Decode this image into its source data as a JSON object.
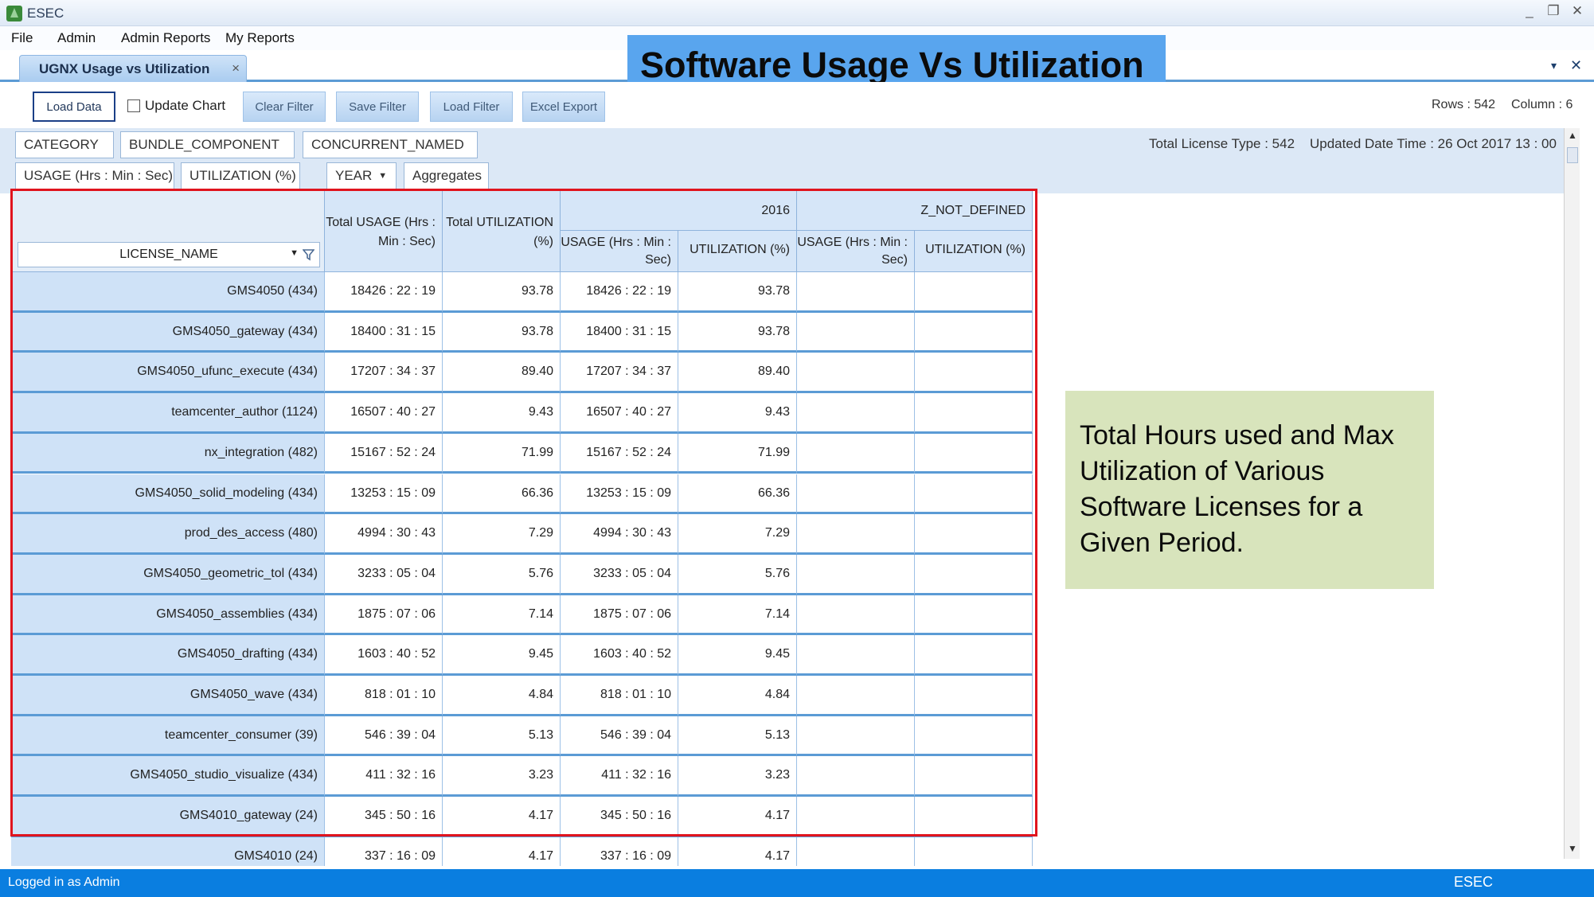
{
  "window": {
    "title": "ESEC",
    "minimize": "_",
    "restore": "❐",
    "close": "✕"
  },
  "menu": [
    "File",
    "Admin",
    "Admin Reports",
    "My Reports"
  ],
  "doc_tab": {
    "label": "UGNX Usage vs Utilization",
    "close": "×"
  },
  "strip_controls": {
    "dropdown": "▾",
    "close": "✕"
  },
  "banner": "Software  Usage Vs Utilization",
  "toolbar": {
    "load_data": "Load Data",
    "update_chart": "Update Chart",
    "clear_filter": "Clear Filter",
    "save_filter": "Save Filter",
    "load_filter": "Load Filter",
    "excel_export": "Excel Export",
    "rows": "Rows : 542",
    "columns": "Column : 6"
  },
  "filters": {
    "row1": [
      "CATEGORY",
      "BUNDLE_COMPONENT",
      "CONCURRENT_NAMED"
    ],
    "row2": [
      "USAGE (Hrs : Min : Sec)",
      "UTILIZATION (%)",
      "YEAR",
      "Aggregates"
    ],
    "total_license": "Total License Type : 542",
    "updated": "Updated Date Time : 26 Oct 2017   13 : 00"
  },
  "grid": {
    "row_header": "LICENSE_NAME",
    "total_usage_header": "Total USAGE (Hrs : Min : Sec)",
    "total_util_header": "Total UTILIZATION (%)",
    "group_2016": "2016",
    "group_undefined": "Z_NOT_DEFINED",
    "usage_sub": "USAGE (Hrs : Min : Sec)",
    "util_sub": "UTILIZATION (%)",
    "rows": [
      {
        "name": "GMS4050 (434)",
        "total_usage": "18426 : 22 : 19",
        "total_util": "93.78",
        "usage_2016": "18426 : 22 : 19",
        "util_2016": "93.78"
      },
      {
        "name": "GMS4050_gateway (434)",
        "total_usage": "18400 : 31 : 15",
        "total_util": "93.78",
        "usage_2016": "18400 : 31 : 15",
        "util_2016": "93.78"
      },
      {
        "name": "GMS4050_ufunc_execute (434)",
        "total_usage": "17207 : 34 : 37",
        "total_util": "89.40",
        "usage_2016": "17207 : 34 : 37",
        "util_2016": "89.40"
      },
      {
        "name": "teamcenter_author (1124)",
        "total_usage": "16507 : 40 : 27",
        "total_util": "9.43",
        "usage_2016": "16507 : 40 : 27",
        "util_2016": "9.43"
      },
      {
        "name": "nx_integration (482)",
        "total_usage": "15167 : 52 : 24",
        "total_util": "71.99",
        "usage_2016": "15167 : 52 : 24",
        "util_2016": "71.99"
      },
      {
        "name": "GMS4050_solid_modeling (434)",
        "total_usage": "13253 : 15 : 09",
        "total_util": "66.36",
        "usage_2016": "13253 : 15 : 09",
        "util_2016": "66.36"
      },
      {
        "name": "prod_des_access (480)",
        "total_usage": "4994 : 30 : 43",
        "total_util": "7.29",
        "usage_2016": "4994 : 30 : 43",
        "util_2016": "7.29"
      },
      {
        "name": "GMS4050_geometric_tol (434)",
        "total_usage": "3233 : 05 : 04",
        "total_util": "5.76",
        "usage_2016": "3233 : 05 : 04",
        "util_2016": "5.76"
      },
      {
        "name": "GMS4050_assemblies (434)",
        "total_usage": "1875 : 07 : 06",
        "total_util": "7.14",
        "usage_2016": "1875 : 07 : 06",
        "util_2016": "7.14"
      },
      {
        "name": "GMS4050_drafting (434)",
        "total_usage": "1603 : 40 : 52",
        "total_util": "9.45",
        "usage_2016": "1603 : 40 : 52",
        "util_2016": "9.45"
      },
      {
        "name": "GMS4050_wave (434)",
        "total_usage": "818 : 01 : 10",
        "total_util": "4.84",
        "usage_2016": "818 : 01 : 10",
        "util_2016": "4.84"
      },
      {
        "name": "teamcenter_consumer (39)",
        "total_usage": "546 : 39 : 04",
        "total_util": "5.13",
        "usage_2016": "546 : 39 : 04",
        "util_2016": "5.13"
      },
      {
        "name": "GMS4050_studio_visualize (434)",
        "total_usage": "411 : 32 : 16",
        "total_util": "3.23",
        "usage_2016": "411 : 32 : 16",
        "util_2016": "3.23"
      },
      {
        "name": "GMS4010_gateway (24)",
        "total_usage": "345 : 50 : 16",
        "total_util": "4.17",
        "usage_2016": "345 : 50 : 16",
        "util_2016": "4.17"
      },
      {
        "name": "GMS4010 (24)",
        "total_usage": "337 : 16 : 09",
        "total_util": "4.17",
        "usage_2016": "337 : 16 : 09",
        "util_2016": "4.17"
      }
    ]
  },
  "side_note": "Total Hours used and Max Utilization of Various Software Licenses for a Given Period.",
  "status": {
    "left": "Logged in as Admin",
    "app": "ESEC"
  },
  "colors": {
    "accent": "#0a7ee0",
    "banner": "#59a5ee",
    "highlight": "#e0141e",
    "note": "#d8e4bc"
  }
}
